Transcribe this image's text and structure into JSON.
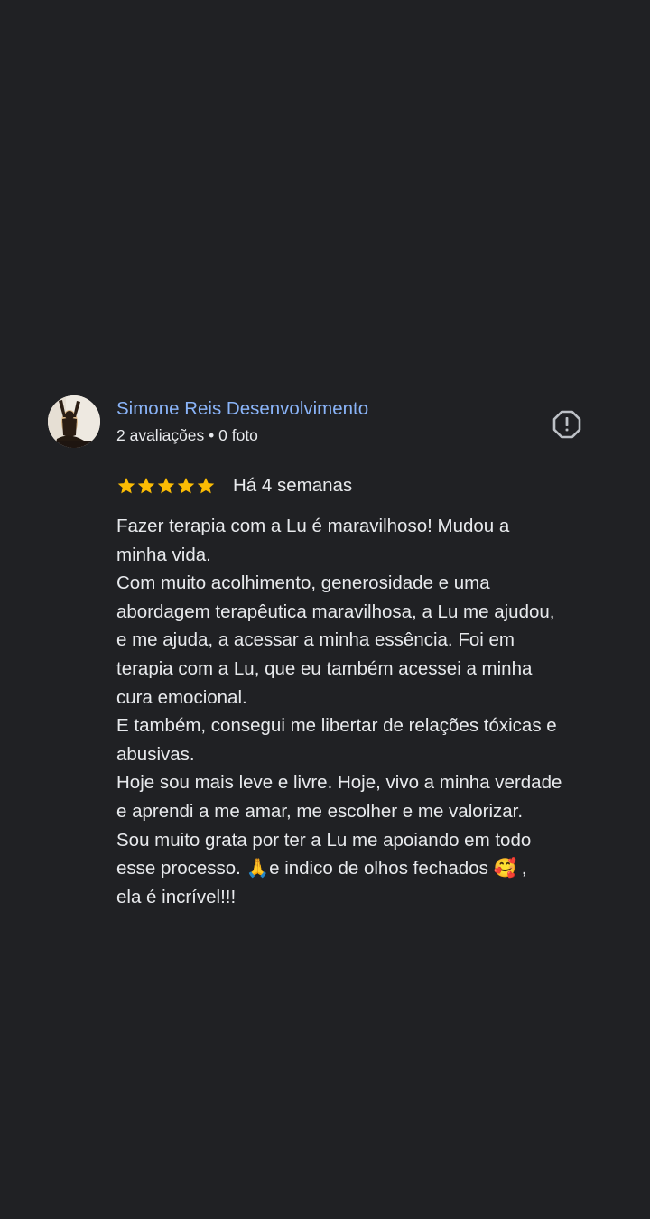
{
  "review": {
    "author": {
      "name": "Simone Reis Desenvolvimento",
      "meta": "2 avaliações • 0 foto",
      "avatar_icon": "person-silhouette-avatar"
    },
    "report_icon": "report-exclamation-icon",
    "rating": 5,
    "rating_max": 5,
    "star_color": "#fbbc04",
    "date": "Há 4 semanas",
    "lines": [
      "Fazer terapia com a Lu é maravilhoso! Mudou a\nminha vida.",
      "Com muito acolhimento, generosidade e uma\nabordagem terapêutica maravilhosa, a Lu me ajudou,\ne me ajuda, a acessar a minha essência. Foi em\nterapia com a Lu, que eu também acessei a minha\ncura emocional.",
      "E também, consegui me libertar de relações tóxicas e\nabusivas.",
      "Hoje sou mais leve e livre. Hoje, vivo a minha verdade\ne aprendi a me amar, me escolher e me valorizar.",
      "Sou muito grata por ter a Lu me apoiando em todo\nesse processo. 🙏e indico de olhos fechados 🥰 ,\nela é incrível!!!"
    ]
  },
  "colors": {
    "background": "#202124",
    "link": "#8ab4f8",
    "text": "#e8eaed"
  }
}
